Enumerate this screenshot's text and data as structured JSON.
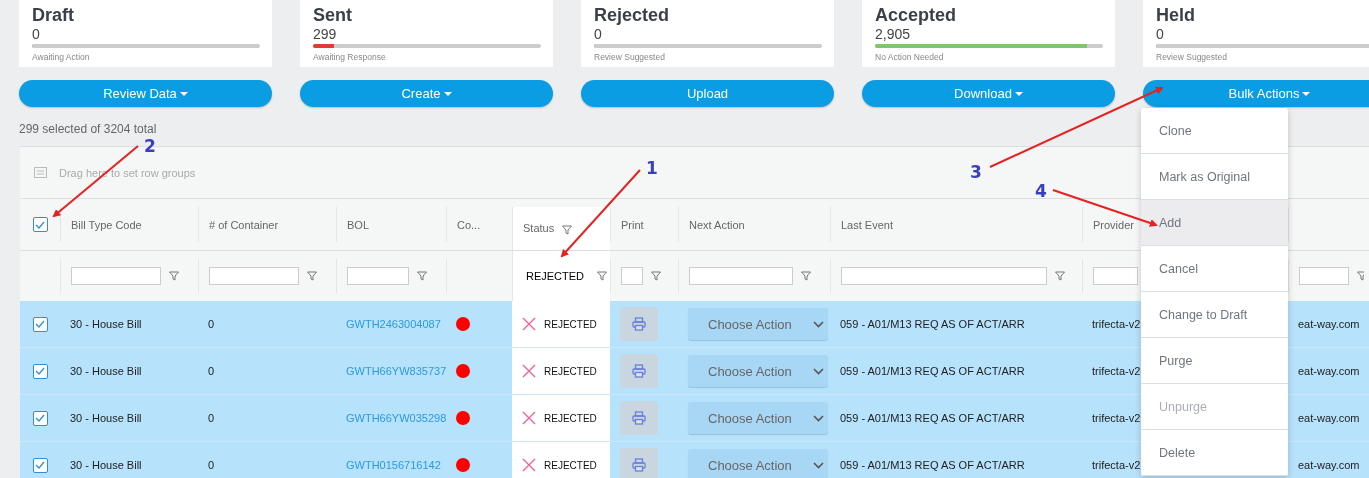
{
  "cards": [
    {
      "title": "Draft",
      "count": "0",
      "level": 0,
      "caption": "Awaiting Action"
    },
    {
      "title": "Sent",
      "count": "299",
      "level": 0.09,
      "color": "#e53935",
      "caption": "Awaiting Response"
    },
    {
      "title": "Rejected",
      "count": "0",
      "level": 0,
      "caption": "Review Suggested"
    },
    {
      "title": "Accepted",
      "count": "2,905",
      "level": 0.93,
      "color": "#7dc66b",
      "caption": "No Action Needed"
    },
    {
      "title": "Held",
      "count": "0",
      "level": 0,
      "caption": "Review Suggested"
    }
  ],
  "buttons": [
    {
      "label": "Review Data",
      "dropdown": true
    },
    {
      "label": "Create",
      "dropdown": true
    },
    {
      "label": "Upload",
      "dropdown": false
    },
    {
      "label": "Download",
      "dropdown": true
    },
    {
      "label": "Bulk Actions",
      "dropdown": true
    }
  ],
  "selection_summary": "299 selected of 3204 total",
  "table": {
    "group_bar": "Drag here to set row groups",
    "header_checked": true,
    "columns": [
      {
        "label": "Bill Type Code",
        "kind": "text",
        "filtered": false
      },
      {
        "label": "# of Container",
        "kind": "text",
        "filtered": false
      },
      {
        "label": "BOL",
        "kind": "link",
        "filtered": false
      },
      {
        "label": "Co...",
        "kind": "dot",
        "filtered": false
      },
      {
        "label": "Status",
        "kind": "status",
        "filtered": true,
        "filter_value": "REJECTED"
      },
      {
        "label": "Print",
        "kind": "print",
        "filtered": false
      },
      {
        "label": "Next Action",
        "kind": "select",
        "filtered": false
      },
      {
        "label": "Last Event",
        "kind": "text",
        "filtered": false
      },
      {
        "label": "Provider",
        "kind": "text",
        "filtered": false
      },
      {
        "kind": "text",
        "filtered": false
      }
    ],
    "rows": [
      {
        "selected": true,
        "bill_type": "30 - House Bill",
        "containers": "0",
        "bol": "GWTH2463004087",
        "color": "#ff0000",
        "status": "REJECTED",
        "next_action": "Choose Action",
        "last_event": "059 - A01/M13 REQ AS OF ACT/ARR",
        "provider": "trifecta-v2",
        "column_10": "eat-way.com"
      },
      {
        "selected": true,
        "bill_type": "30 - House Bill",
        "containers": "0",
        "bol": "GWTH66YW835737",
        "color": "#ff0000",
        "status": "REJECTED",
        "next_action": "Choose Action",
        "last_event": "059 - A01/M13 REQ AS OF ACT/ARR",
        "provider": "trifecta-v2",
        "column_10": "eat-way.com"
      },
      {
        "selected": true,
        "bill_type": "30 - House Bill",
        "containers": "0",
        "bol": "GWTH66YW035298",
        "color": "#ff0000",
        "status": "REJECTED",
        "next_action": "Choose Action",
        "last_event": "059 - A01/M13 REQ AS OF ACT/ARR",
        "provider": "trifecta-v2",
        "column_10": "eat-way.com"
      },
      {
        "selected": true,
        "bill_type": "30 - House Bill",
        "containers": "0",
        "bol": "GWTH0156716142",
        "color": "#ff0000",
        "status": "REJECTED",
        "next_action": "Choose Action",
        "last_event": "059 - A01/M13 REQ AS OF ACT/ARR",
        "provider": "trifecta-v2",
        "column_10": "eat-way.com"
      }
    ]
  },
  "bulk_menu": [
    {
      "label": "Clone",
      "highlighted": false,
      "disabled": false
    },
    {
      "label": "Mark as Original",
      "highlighted": false,
      "disabled": false
    },
    {
      "label": "Add",
      "highlighted": true,
      "disabled": false
    },
    {
      "label": "Cancel",
      "highlighted": false,
      "disabled": false
    },
    {
      "label": "Change to Draft",
      "highlighted": false,
      "disabled": false
    },
    {
      "label": "Purge",
      "highlighted": false,
      "disabled": false
    },
    {
      "label": "Unpurge",
      "highlighted": false,
      "disabled": true
    },
    {
      "label": "Delete",
      "highlighted": false,
      "disabled": false
    }
  ],
  "annotations": [
    {
      "label": "1"
    },
    {
      "label": "2"
    },
    {
      "label": "3"
    },
    {
      "label": "4"
    }
  ]
}
